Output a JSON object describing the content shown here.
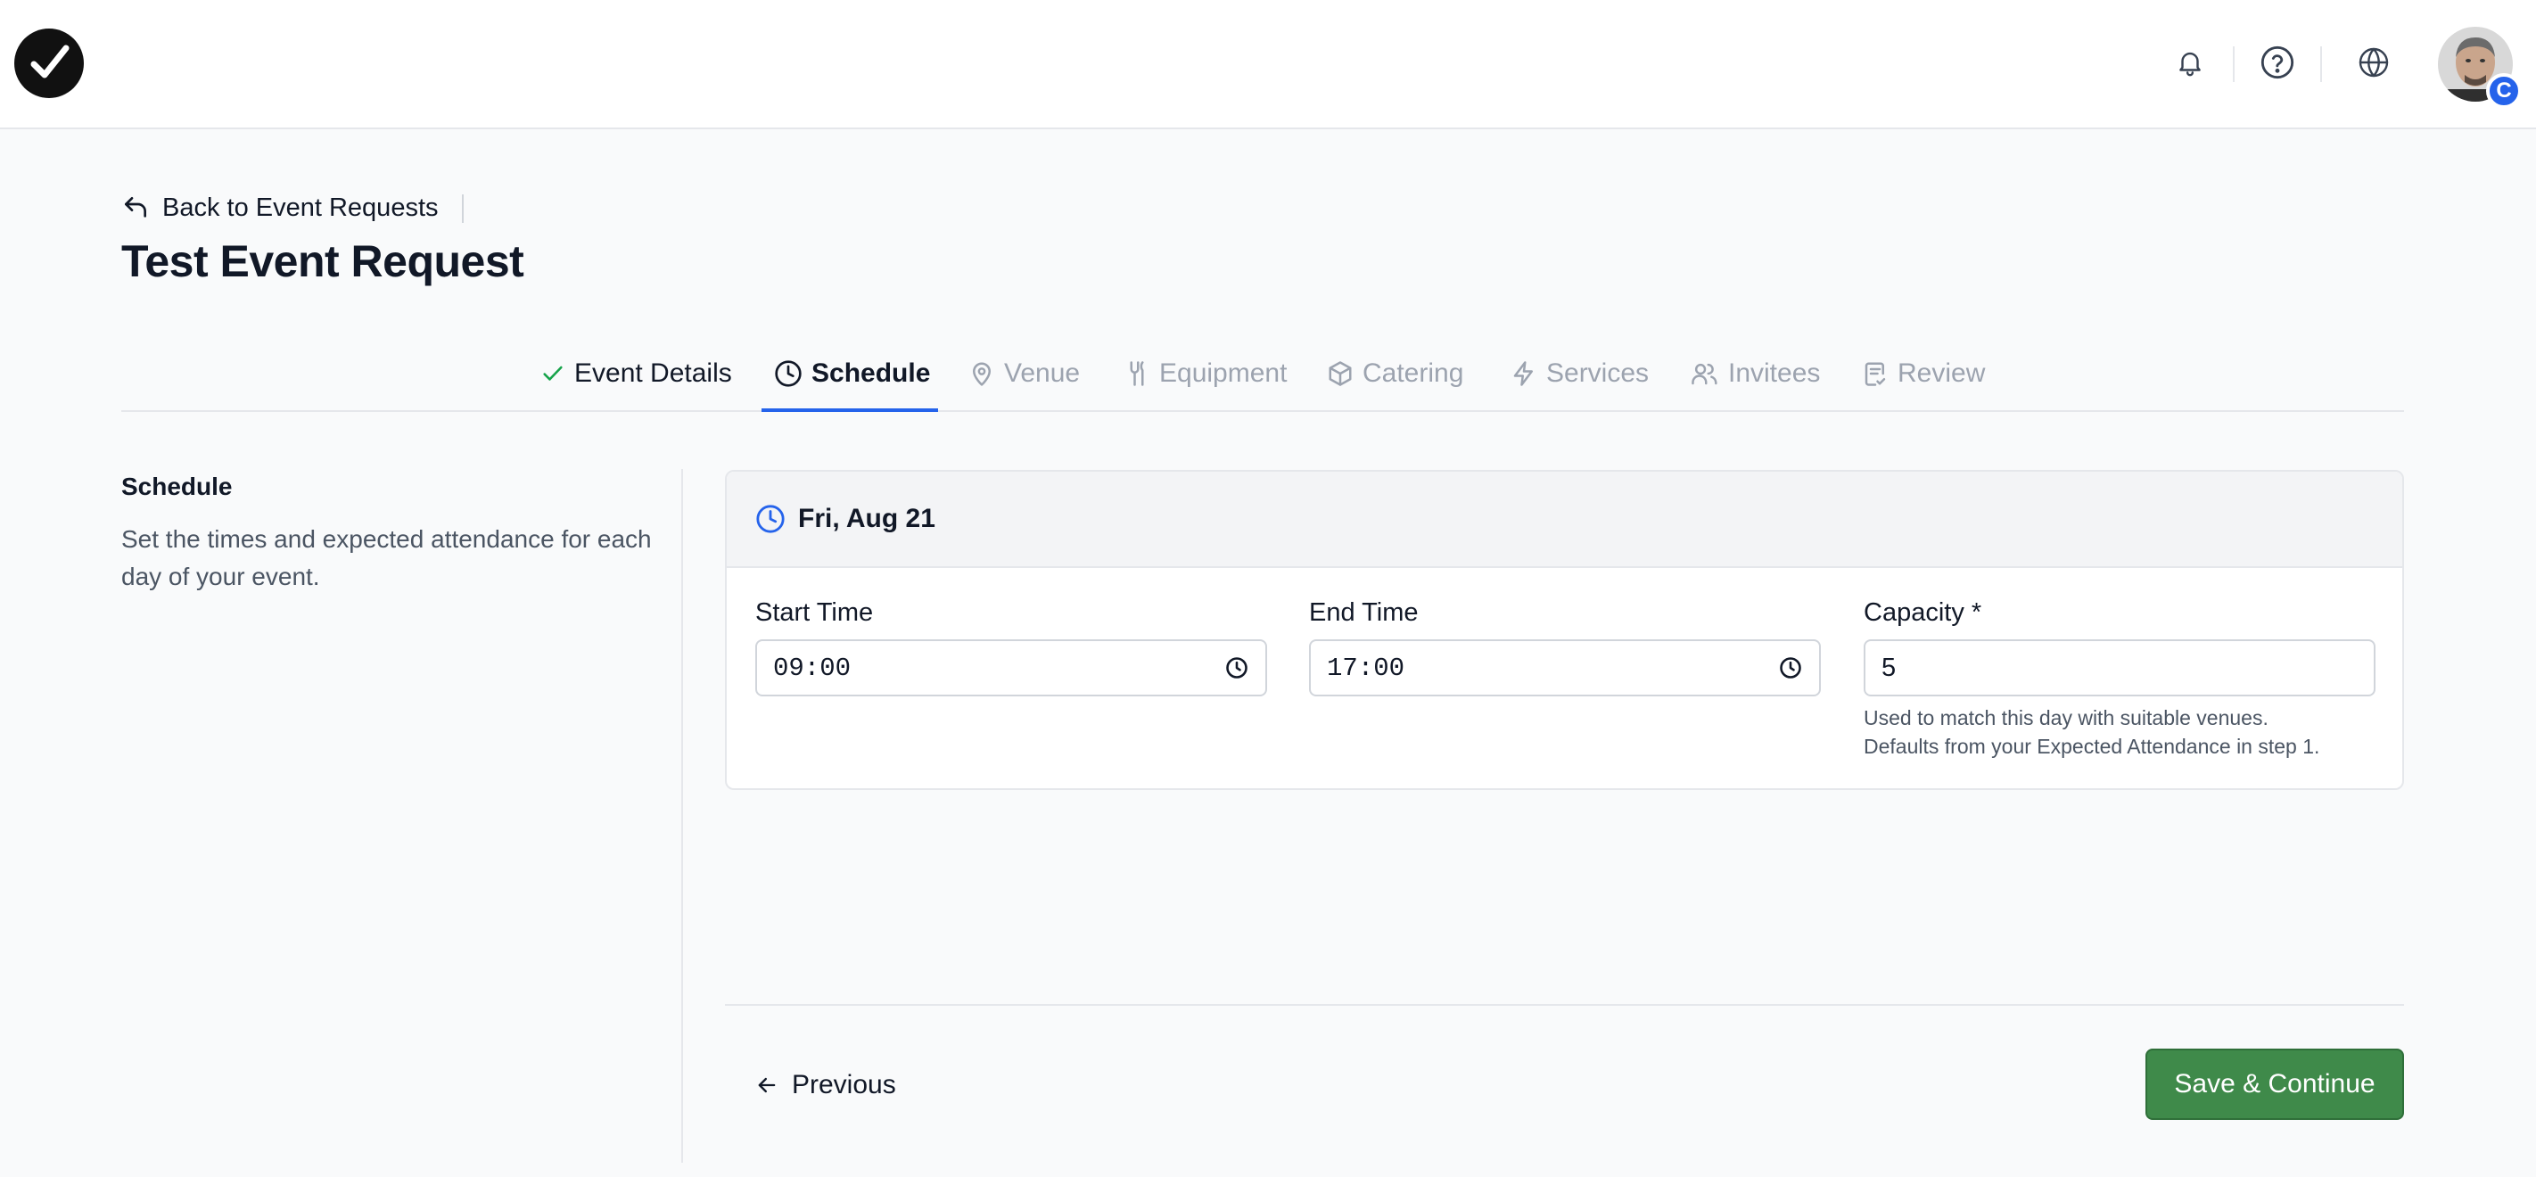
{
  "header": {
    "logo_icon": "checkmark-logo-icon",
    "icons": [
      "bell-icon",
      "help-icon",
      "globe-icon"
    ],
    "avatar_badge": "C"
  },
  "page": {
    "back_label": "Back to Event Requests",
    "title": "Test Event Request"
  },
  "tabs": [
    {
      "label": "Event Details",
      "icon": "check-icon",
      "state": "done"
    },
    {
      "label": "Schedule",
      "icon": "clock-icon",
      "state": "active"
    },
    {
      "label": "Venue",
      "icon": "map-pin-icon",
      "state": "pending"
    },
    {
      "label": "Equipment",
      "icon": "wrench-icon",
      "state": "pending"
    },
    {
      "label": "Catering",
      "icon": "box-icon",
      "state": "pending"
    },
    {
      "label": "Services",
      "icon": "bolt-icon",
      "state": "pending"
    },
    {
      "label": "Invitees",
      "icon": "users-icon",
      "state": "pending"
    },
    {
      "label": "Review",
      "icon": "clipboard-check-icon",
      "state": "pending"
    }
  ],
  "section": {
    "title": "Schedule",
    "description": "Set the times and expected attendance for each day of your event."
  },
  "day_card": {
    "date": "Fri, Aug 21",
    "start_label": "Start Time",
    "start_value": "09:00",
    "end_label": "End Time",
    "end_value": "17:00",
    "capacity_label": "Capacity *",
    "capacity_value": "5",
    "capacity_helper_1": "Used to match this day with suitable venues.",
    "capacity_helper_2": "Defaults from your Expected Attendance in step 1."
  },
  "footer": {
    "previous_label": "Previous",
    "save_label": "Save & Continue"
  },
  "colors": {
    "accent": "#2563eb",
    "primary_button": "#3f8a4a",
    "background": "#f9fafb"
  }
}
